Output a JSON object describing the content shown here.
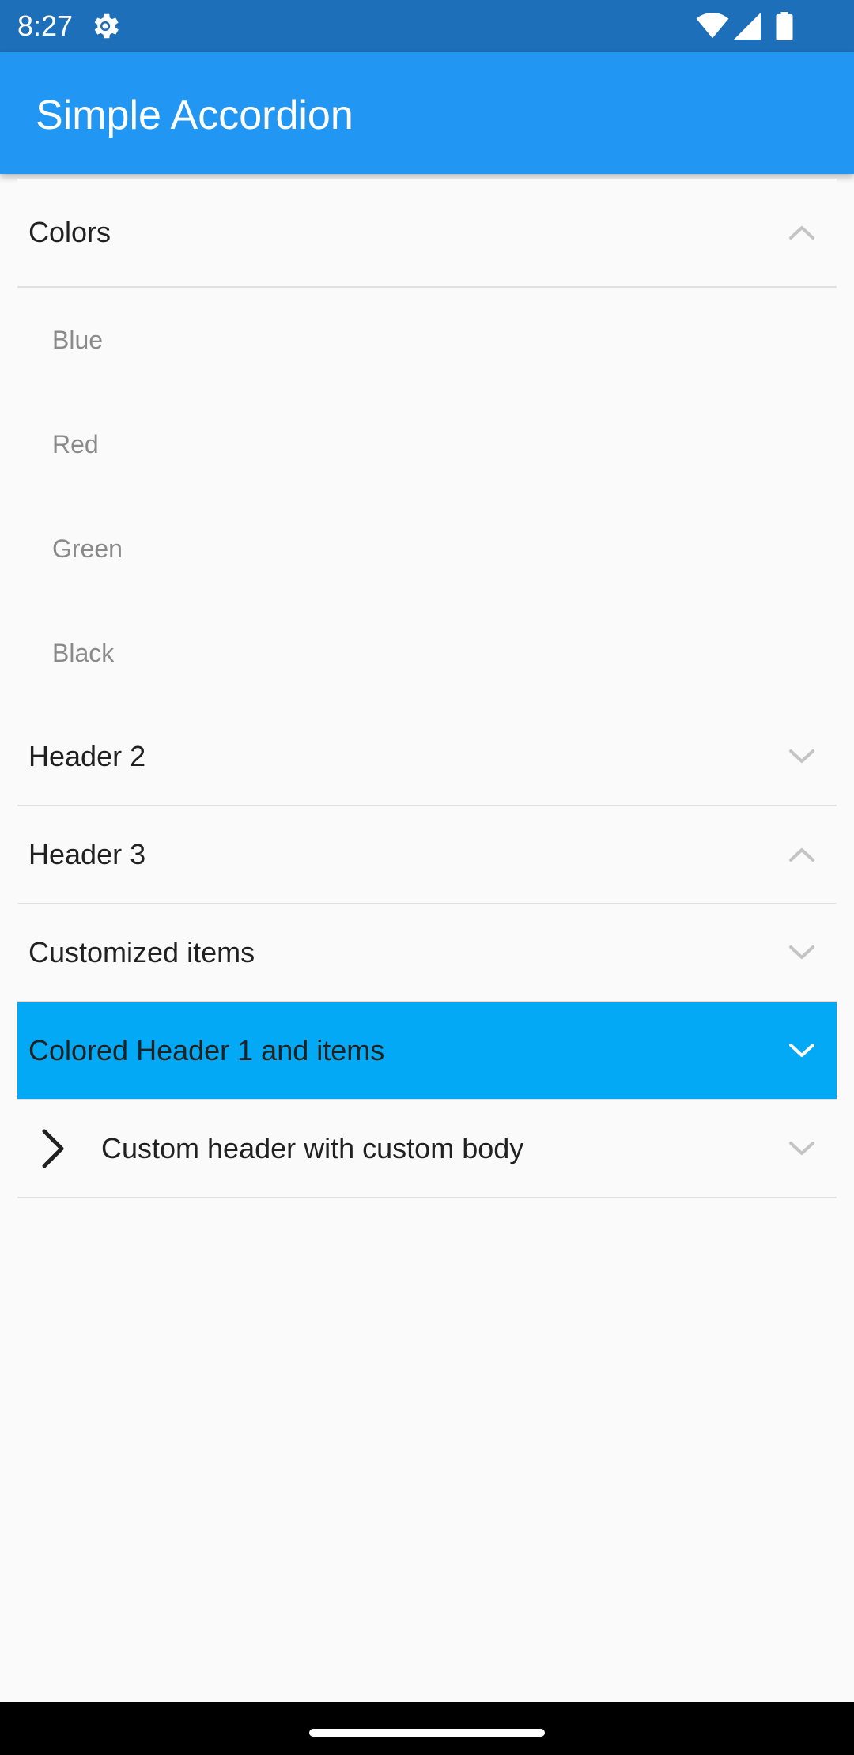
{
  "status_bar": {
    "time": "8:27",
    "icons": [
      "settings-gear-icon",
      "wifi-icon",
      "signal-icon",
      "battery-icon"
    ]
  },
  "app_bar": {
    "title": "Simple Accordion",
    "color": "#2196f3"
  },
  "accordion": {
    "sections": [
      {
        "title": "Colors",
        "expanded": true,
        "chevron": "chevron-up-icon",
        "items": [
          "Blue",
          "Red",
          "Green",
          "Black"
        ]
      },
      {
        "title": "Header 2",
        "expanded": false,
        "chevron": "chevron-down-icon"
      },
      {
        "title": "Header 3",
        "expanded": false,
        "chevron": "chevron-up-icon"
      },
      {
        "title": "Customized items",
        "expanded": false,
        "chevron": "chevron-down-icon"
      },
      {
        "title": "Colored Header 1 and items",
        "expanded": false,
        "chevron": "chevron-down-icon",
        "background": "#03a9f4"
      },
      {
        "title": "Custom header with custom body",
        "expanded": false,
        "chevron": "chevron-down-icon",
        "leading_icon": "chevron-right-icon"
      }
    ]
  },
  "colors": {
    "status_bar": "#1e6fb9",
    "accent": "#2196f3",
    "colored_header": "#03a9f4",
    "background": "#fafafa"
  }
}
